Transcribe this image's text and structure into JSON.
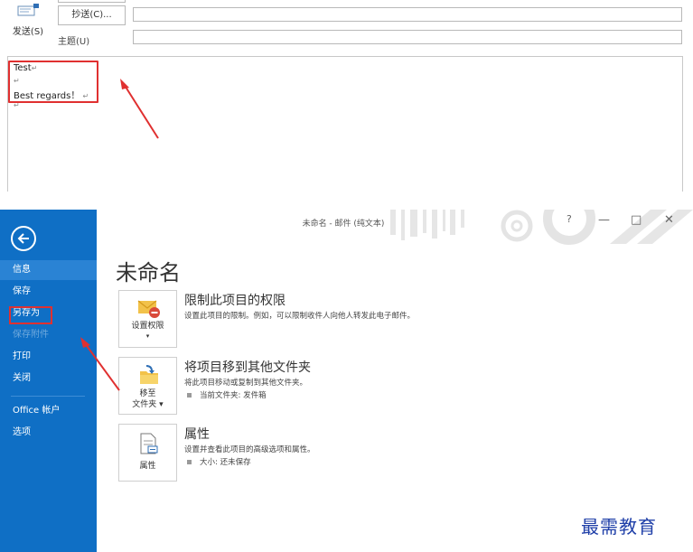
{
  "compose": {
    "send_label": "发送(S)",
    "cc_label": "抄送(C)...",
    "subject_label": "主题(U)",
    "body_lines": [
      "Test",
      "",
      "Best regards！",
      ""
    ],
    "para_mark": "↵"
  },
  "backstage": {
    "window_title": "未命名 - 邮件 (纯文本)",
    "window_controls": [
      "?",
      "—",
      "□",
      "✕"
    ],
    "page_title": "未命名",
    "nav": [
      "信息",
      "保存",
      "另存为",
      "保存附件",
      "打印",
      "关闭",
      "Office 帐户",
      "选项"
    ],
    "sections": [
      {
        "tile_label": "设置权限",
        "tile_sub": "▾",
        "title": "限制此项目的权限",
        "desc": "设置此项目的限制。例如，可以限制收件人向他人转发此电子邮件。"
      },
      {
        "tile_label": "移至",
        "tile_label2": "文件夹 ▾",
        "title": "将项目移到其他文件夹",
        "desc": "将此项目移动或复制到其他文件夹。",
        "bullet": "当前文件夹:  发件箱"
      },
      {
        "tile_label": "属性",
        "title": "属性",
        "desc": "设置并查看此项目的高级选项和属性。",
        "bullet": "大小:  还未保存"
      }
    ]
  },
  "watermark": "最需教育",
  "colors": {
    "sidebar": "#0f6fc5",
    "annotation": "#e03030",
    "watermark": "#1f3fa8"
  }
}
